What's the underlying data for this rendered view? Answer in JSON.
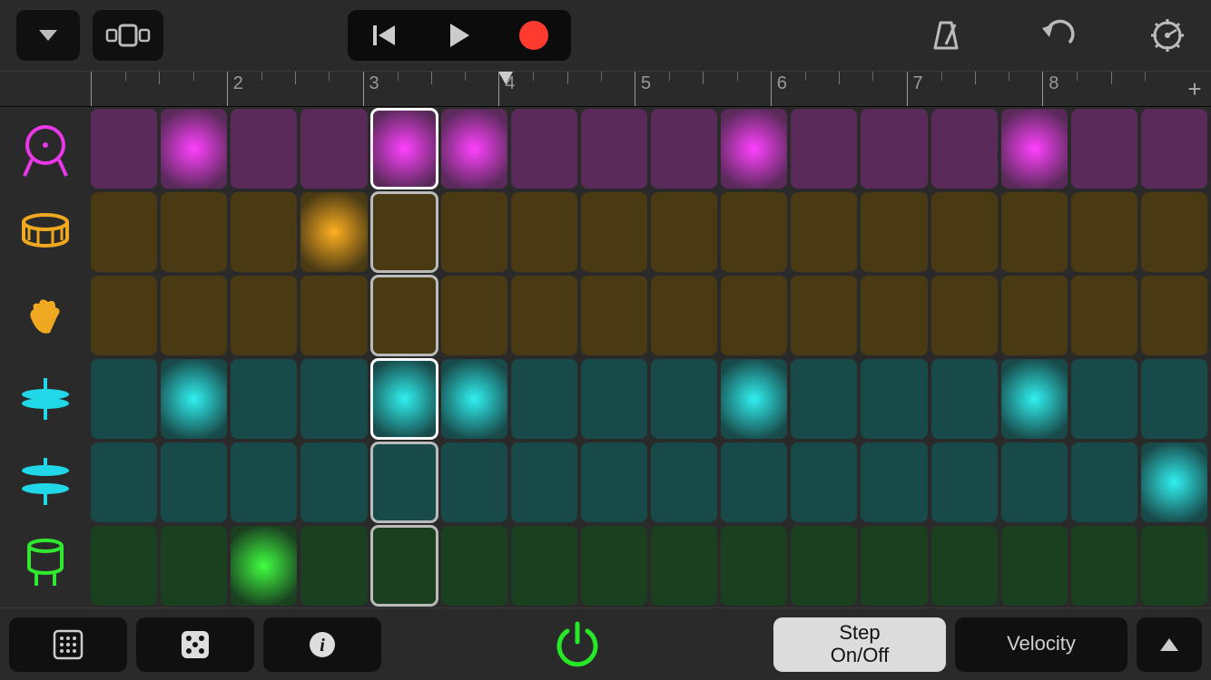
{
  "ruler": {
    "labels": [
      "",
      "2",
      "3",
      "4",
      "5",
      "6",
      "7",
      "8"
    ]
  },
  "playhead_step": 5,
  "steps": 16,
  "bottom": {
    "step_label": "Step\nOn/Off",
    "velocity_label": "Velocity"
  },
  "tracks": [
    {
      "id": "kick",
      "icon": "kick-icon",
      "color_icon": "#e838e8",
      "base": "#5a2a5a",
      "glow": "#ff40ff",
      "active_steps": [
        1,
        5,
        9,
        13
      ],
      "playhead_lit": true
    },
    {
      "id": "snare",
      "icon": "snare-icon",
      "color_icon": "#f0a820",
      "base": "#4a3a14",
      "glow": "#ffb020",
      "active_steps": [
        3
      ],
      "playhead_lit": false
    },
    {
      "id": "clap",
      "icon": "clap-icon",
      "color_icon": "#f0a820",
      "base": "#4a3a14",
      "glow": "#ffb020",
      "active_steps": [],
      "playhead_lit": false
    },
    {
      "id": "hihat-closed",
      "icon": "hihat-closed-icon",
      "color_icon": "#20d8e8",
      "base": "#184a4a",
      "glow": "#30f0f0",
      "active_steps": [
        1,
        5,
        9,
        13
      ],
      "playhead_lit": true
    },
    {
      "id": "hihat-open",
      "icon": "hihat-open-icon",
      "color_icon": "#20d8e8",
      "base": "#184a4a",
      "glow": "#30f0f0",
      "active_steps": [
        15
      ],
      "playhead_lit": false
    },
    {
      "id": "tom",
      "icon": "tom-icon",
      "color_icon": "#30e830",
      "base": "#1a4020",
      "glow": "#40ff40",
      "active_steps": [
        2
      ],
      "playhead_lit": false
    }
  ]
}
